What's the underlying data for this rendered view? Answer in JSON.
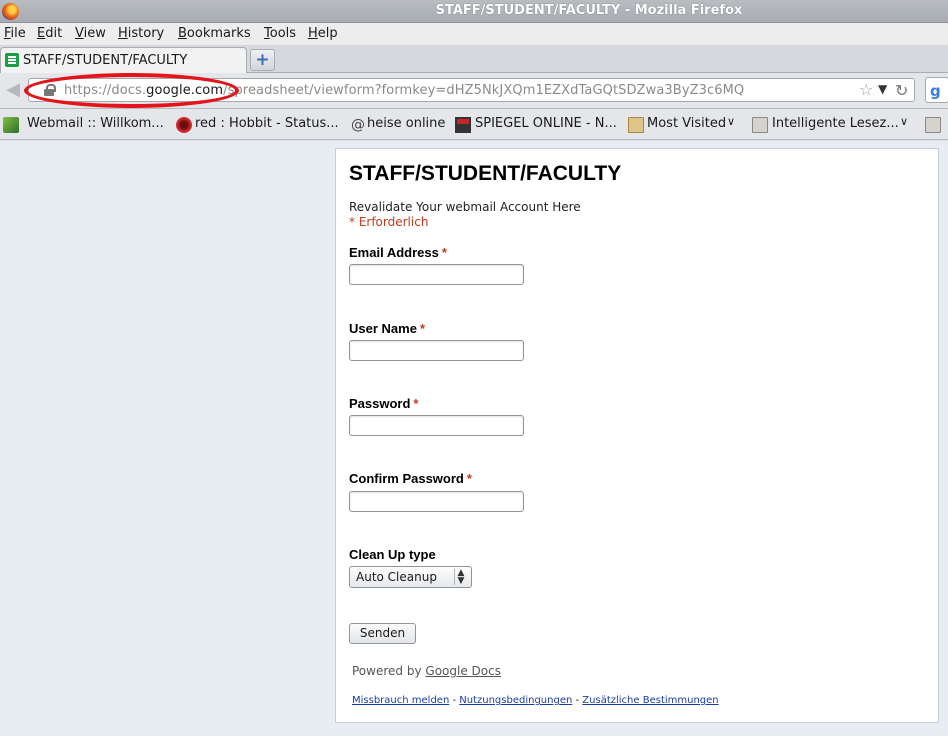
{
  "window": {
    "title": "STAFF/STUDENT/FACULTY - Mozilla Firefox"
  },
  "menu": [
    "File",
    "Edit",
    "View",
    "History",
    "Bookmarks",
    "Tools",
    "Help"
  ],
  "tab": {
    "label": "STAFF/STUDENT/FACULTY",
    "new_tab": "+"
  },
  "url": {
    "prefix": "https://docs.",
    "host": "google.com",
    "path": "/spreadsheet/viewform?formkey=dHZ5NkJXQm1EZXdTaGQtSDZwa3ByZ3c6MQ"
  },
  "bookmarks": [
    "Webmail :: Willkom...",
    "red : Hobbit - Status...",
    "heise online",
    "SPIEGEL ONLINE - N...",
    "Most Visited",
    "Intelligente Lesez..."
  ],
  "form": {
    "title": "STAFF/STUDENT/FACULTY",
    "description": "Revalidate Your webmail Account Here",
    "required_note": "* Erforderlich",
    "required_mark": "*",
    "fields": [
      {
        "label": "Email Address",
        "value": ""
      },
      {
        "label": "User Name",
        "value": ""
      },
      {
        "label": "Password",
        "value": ""
      },
      {
        "label": "Confirm Password",
        "value": ""
      }
    ],
    "cleanup": {
      "label": "Clean Up type",
      "selected": "Auto Cleanup"
    },
    "submit_label": "Senden",
    "powered_prefix": "Powered by",
    "powered_link": "Google Docs",
    "footer": {
      "abuse": "Missbrauch melden",
      "sep": "-",
      "terms": "Nutzungsbedingungen",
      "extra": "Zusätzliche Bestimmungen"
    }
  },
  "colors": {
    "required": "#c43a1a",
    "annotation": "#e3151b",
    "link": "#1a3da8"
  }
}
